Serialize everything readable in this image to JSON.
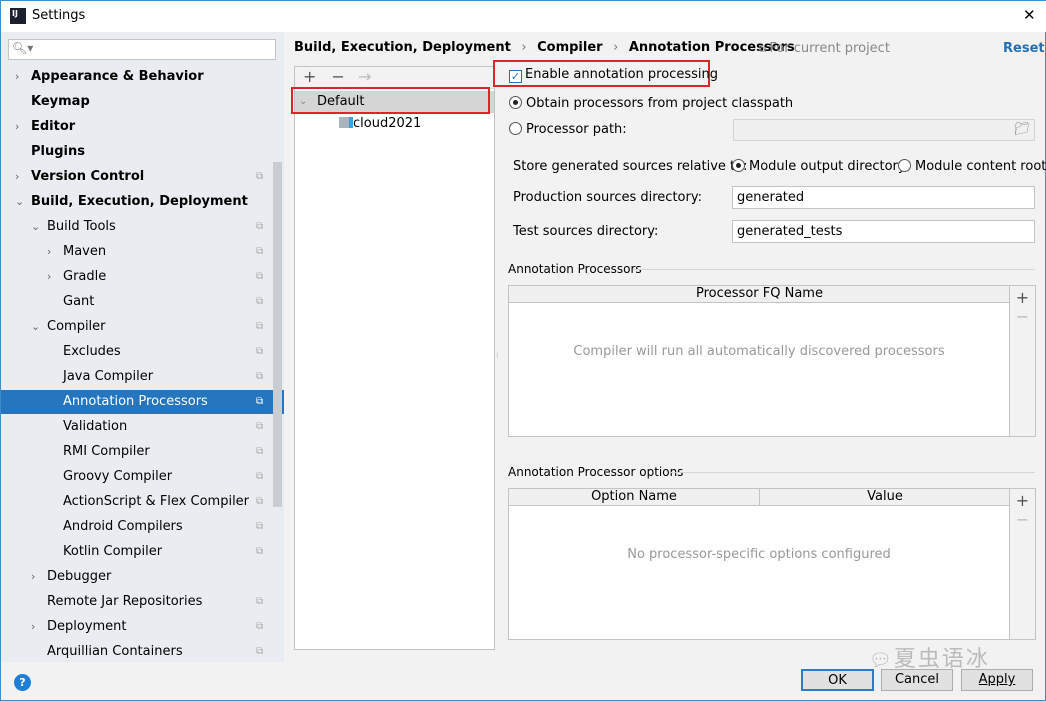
{
  "window": {
    "title": "Settings",
    "close": "✕",
    "app_icon": "IJ"
  },
  "search": {
    "placeholder": "",
    "icon": "search-icon"
  },
  "sidebar": {
    "items": [
      {
        "label": "Appearance & Behavior",
        "level": 0,
        "arrow": "›",
        "bold": true,
        "copy": false
      },
      {
        "label": "Keymap",
        "level": 0,
        "arrow": "",
        "bold": true,
        "copy": false
      },
      {
        "label": "Editor",
        "level": 0,
        "arrow": "›",
        "bold": true,
        "copy": false
      },
      {
        "label": "Plugins",
        "level": 0,
        "arrow": "",
        "bold": true,
        "copy": false
      },
      {
        "label": "Version Control",
        "level": 0,
        "arrow": "›",
        "bold": true,
        "copy": true
      },
      {
        "label": "Build, Execution, Deployment",
        "level": 0,
        "arrow": "⌄",
        "bold": true,
        "copy": false
      },
      {
        "label": "Build Tools",
        "level": 1,
        "arrow": "⌄",
        "bold": false,
        "copy": true
      },
      {
        "label": "Maven",
        "level": 2,
        "arrow": "›",
        "bold": false,
        "copy": true
      },
      {
        "label": "Gradle",
        "level": 2,
        "arrow": "›",
        "bold": false,
        "copy": true
      },
      {
        "label": "Gant",
        "level": 2,
        "arrow": "",
        "bold": false,
        "copy": true
      },
      {
        "label": "Compiler",
        "level": 1,
        "arrow": "⌄",
        "bold": false,
        "copy": true
      },
      {
        "label": "Excludes",
        "level": 2,
        "arrow": "",
        "bold": false,
        "copy": true
      },
      {
        "label": "Java Compiler",
        "level": 2,
        "arrow": "",
        "bold": false,
        "copy": true
      },
      {
        "label": "Annotation Processors",
        "level": 2,
        "arrow": "",
        "bold": false,
        "copy": true,
        "selected": true
      },
      {
        "label": "Validation",
        "level": 2,
        "arrow": "",
        "bold": false,
        "copy": true
      },
      {
        "label": "RMI Compiler",
        "level": 2,
        "arrow": "",
        "bold": false,
        "copy": true
      },
      {
        "label": "Groovy Compiler",
        "level": 2,
        "arrow": "",
        "bold": false,
        "copy": true
      },
      {
        "label": "ActionScript & Flex Compiler",
        "level": 2,
        "arrow": "",
        "bold": false,
        "copy": true
      },
      {
        "label": "Android Compilers",
        "level": 2,
        "arrow": "",
        "bold": false,
        "copy": true
      },
      {
        "label": "Kotlin Compiler",
        "level": 2,
        "arrow": "",
        "bold": false,
        "copy": true
      },
      {
        "label": "Debugger",
        "level": 1,
        "arrow": "›",
        "bold": false,
        "copy": false
      },
      {
        "label": "Remote Jar Repositories",
        "level": 1,
        "arrow": "",
        "bold": false,
        "copy": true
      },
      {
        "label": "Deployment",
        "level": 1,
        "arrow": "›",
        "bold": false,
        "copy": true
      },
      {
        "label": "Arquillian Containers",
        "level": 1,
        "arrow": "",
        "bold": false,
        "copy": true
      }
    ]
  },
  "breadcrumb": {
    "items": [
      "Build, Execution, Deployment",
      "Compiler",
      "Annotation Processors"
    ],
    "sep": "›",
    "scope": "For current project",
    "reset": "Reset"
  },
  "profiles": {
    "add": "+",
    "remove": "−",
    "move": "→",
    "items": [
      {
        "label": "Default",
        "expanded": true
      },
      {
        "label": "cloud2021"
      }
    ]
  },
  "form": {
    "enable_label": "Enable annotation processing",
    "enable_checked": true,
    "obtain_label": "Obtain processors from project classpath",
    "obtain_selected": true,
    "path_label": "Processor path:",
    "path_value": "",
    "store_label": "Store generated sources relative to:",
    "module_output": "Module output directory",
    "module_output_selected": true,
    "module_content": "Module content root",
    "prod_label": "Production sources directory:",
    "prod_value": "generated",
    "test_label": "Test sources directory:",
    "test_value": "generated_tests"
  },
  "processors": {
    "title": "Annotation Processors",
    "column": "Processor FQ Name",
    "empty": "Compiler will run all automatically discovered processors",
    "add": "+",
    "remove": "−"
  },
  "options": {
    "title": "Annotation Processor options",
    "columns": [
      "Option Name",
      "Value"
    ],
    "empty": "No processor-specific options configured",
    "add": "+",
    "remove": "−"
  },
  "buttons": {
    "ok": "OK",
    "cancel": "Cancel",
    "apply": "Apply",
    "help": "?"
  },
  "watermark": "夏虫语冰"
}
